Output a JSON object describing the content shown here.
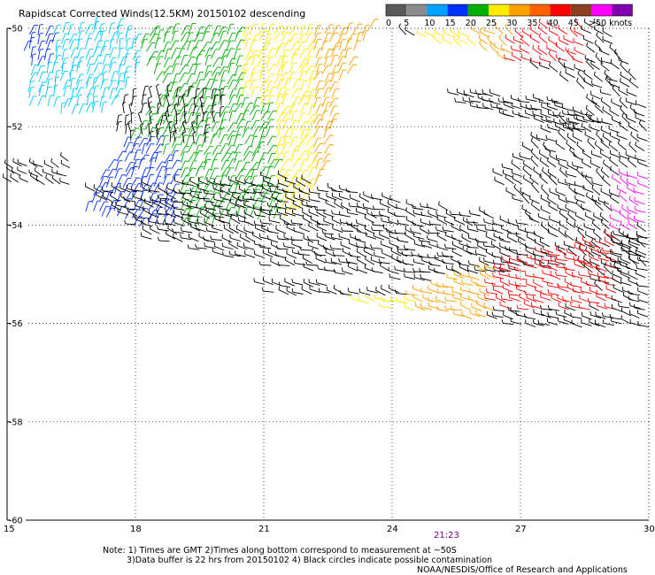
{
  "title": "Rapidscat Corrected Winds(12.5KM) 20150102 descending",
  "legend": {
    "bins": [
      {
        "color": "#5a5a5a"
      },
      {
        "color": "#8c8c8c"
      },
      {
        "color": "#00a0ff"
      },
      {
        "color": "#0030ff"
      },
      {
        "color": "#00b000"
      },
      {
        "color": "#ffea00"
      },
      {
        "color": "#ffa000"
      },
      {
        "color": "#ff6000"
      },
      {
        "color": "#ff0000"
      },
      {
        "color": "#8c4020"
      },
      {
        "color": "#ff00ff"
      },
      {
        "color": "#8000b0"
      }
    ],
    "labels": [
      "0",
      "5",
      "10",
      "15",
      "20",
      "25",
      "30",
      "35",
      "40",
      "45",
      ">50 knots"
    ]
  },
  "map": {
    "lon_range": [
      15,
      30
    ],
    "lat_range": [
      -60,
      -50
    ],
    "lon_ticks": [
      15,
      18,
      21,
      24,
      27,
      30
    ],
    "lat_ticks": [
      -50,
      -52,
      -54,
      -56,
      -58,
      -60
    ],
    "lon_labels": [
      "15",
      "18",
      "21",
      "24",
      "27",
      "30"
    ],
    "lat_labels": [
      "-50",
      "-52",
      "-54",
      "-56",
      "-58",
      "-60"
    ],
    "grid": true
  },
  "timestamp": {
    "text": "21:23",
    "color": "#800080"
  },
  "notes": [
    "Note: 1) Times are GMT 2)Times along bottom correspond to measurement at ~50S",
    "3)Data buffer is 22 hrs from 20150102 4) Black circles indicate possible contamination"
  ],
  "credit": "NOAA/NESDIS/Office of Research and Applications",
  "wind_field": {
    "description_colors": {
      "black": "#000000",
      "light_blue": "#00c8ff",
      "blue": "#0030ff",
      "green": "#00b000",
      "yellow": "#ffea00",
      "orange": "#ffa000",
      "red": "#ff0000",
      "magenta": "#ff00ff"
    }
  }
}
